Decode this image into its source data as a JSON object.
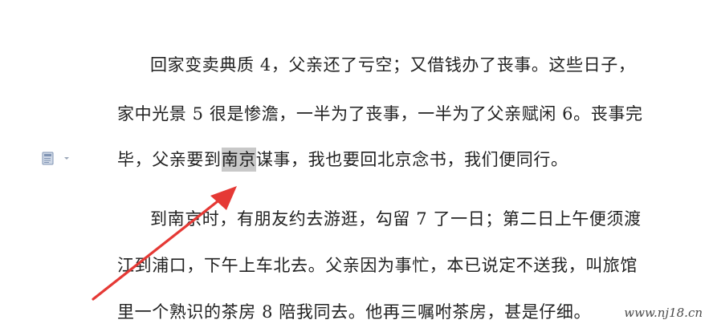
{
  "document": {
    "lines": [
      {
        "text": "回家变卖典质 4，父亲还了亏空；又借钱办了丧事。这些日子，"
      },
      {
        "text": "家中光景 5 很是惨澹，一半为了丧事，一半为了父亲赋闲 6。丧事完"
      },
      {
        "before": "毕，父亲要到",
        "selected": "南京",
        "after": "谋事，我也要回北京念书，我们便同行。"
      },
      {
        "text": "到南京时，有朋友约去游逛，勾留 7 了一日；第二日上午便须渡"
      },
      {
        "text": "江到浦口，下午上车北去。父亲因为事忙，本已说定不送我，叫旅馆"
      },
      {
        "text": "里一个熟识的茶房 8 陪我同去。他再三嘱咐茶房，甚是仔细。"
      }
    ]
  },
  "icons": {
    "paragraph_options": "paste-options-icon",
    "paragraph_dropdown": "chevron-down-icon"
  },
  "annotation": {
    "arrow_color": "#e53935"
  },
  "watermark": {
    "text": "www.nj18.cn"
  }
}
